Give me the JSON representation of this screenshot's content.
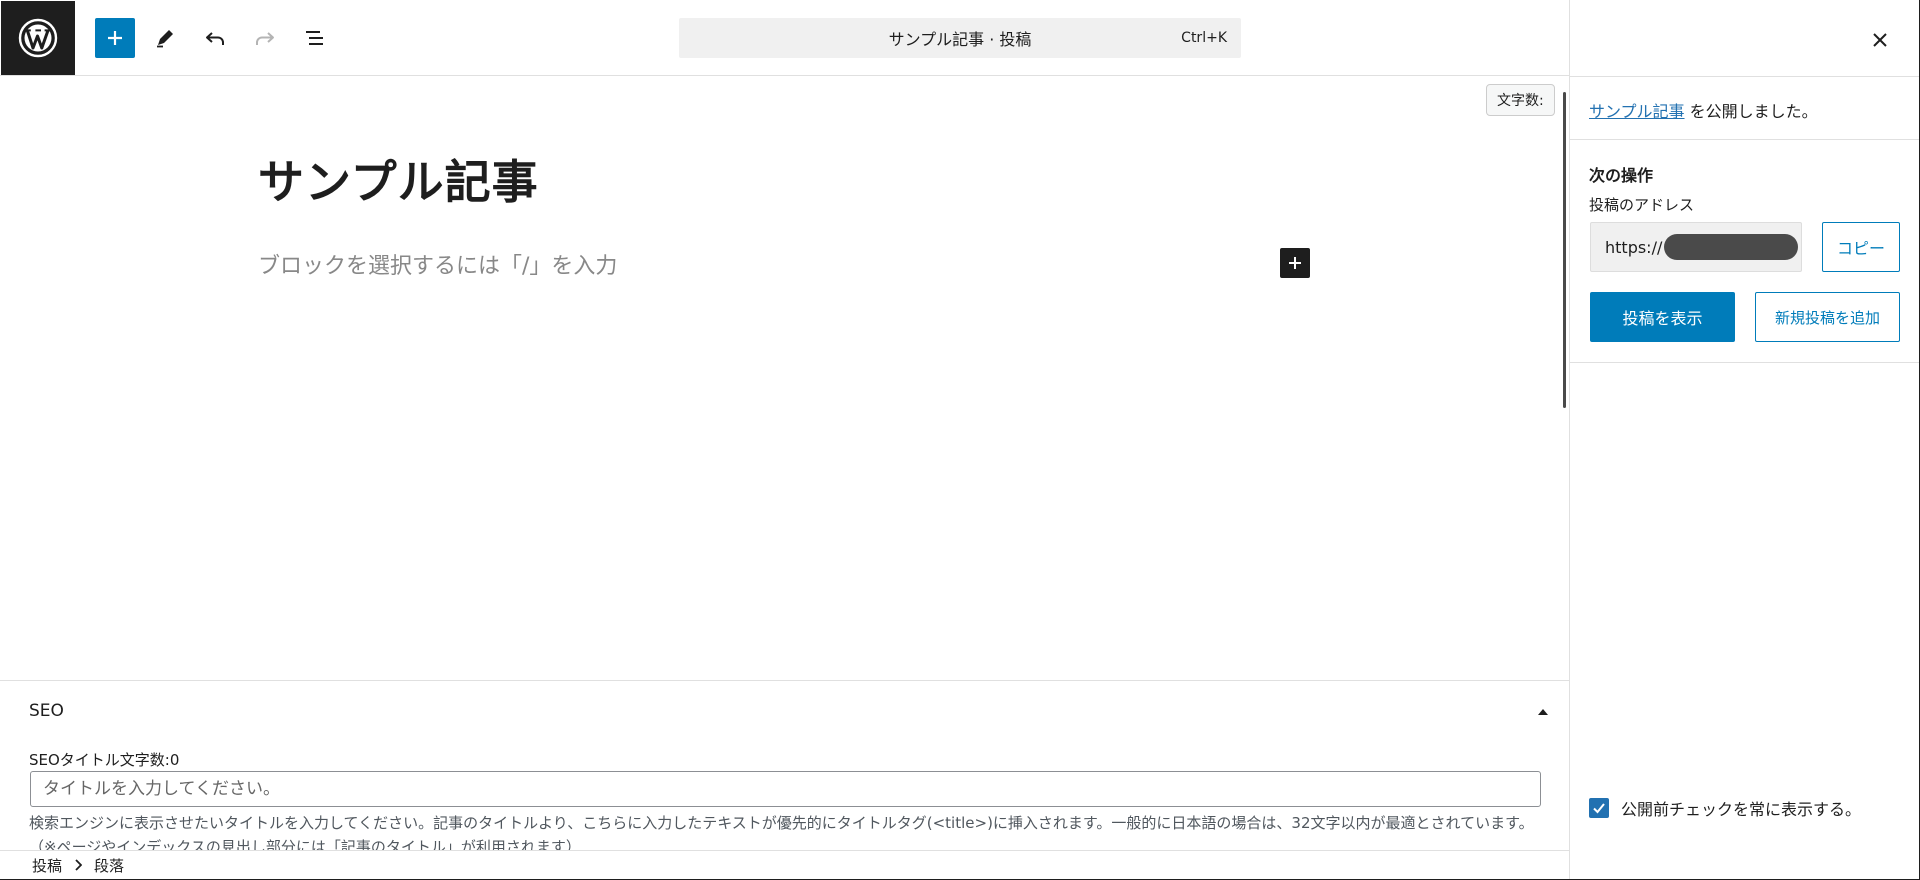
{
  "toolbar": {
    "command_title": "サンプル記事 · 投稿",
    "command_shortcut": "Ctrl+K"
  },
  "editor": {
    "word_count_label": "文字数:",
    "post_title": "サンプル記事",
    "block_placeholder": "ブロックを選択するには「/」を入力"
  },
  "seo": {
    "heading": "SEO",
    "title_label": "SEOタイトル文字数:0",
    "title_placeholder": "タイトルを入力してください。",
    "help_text": "検索エンジンに表示させたいタイトルを入力してください。記事のタイトルより、こちらに入力したテキストが優先的にタイトルタグ(<title>)に挿入されます。一般的に日本語の場合は、32文字以内が最適とされています。（※ページやインデックスの見出し部分には「記事のタイトル」が利用されます）"
  },
  "breadcrumb": {
    "items": [
      "投稿",
      "段落"
    ]
  },
  "panel": {
    "published_link": "サンプル記事",
    "published_suffix": " を公開しました。",
    "next_actions_title": "次の操作",
    "address_label": "投稿のアドレス",
    "url_prefix": "https://",
    "copy_label": "コピー",
    "view_post_label": "投稿を表示",
    "add_new_label": "新規投稿を追加",
    "prepublish_check_label": "公開前チェックを常に表示する。"
  },
  "colors": {
    "accent": "#007cba",
    "link": "#2271b1",
    "dark": "#1e1e1e"
  },
  "icons": [
    "wordpress-logo-icon",
    "plus-icon",
    "pencil-icon",
    "undo-icon",
    "redo-icon",
    "list-view-icon",
    "close-icon",
    "chevron-up-icon",
    "chevron-right-icon",
    "checkmark-icon"
  ]
}
